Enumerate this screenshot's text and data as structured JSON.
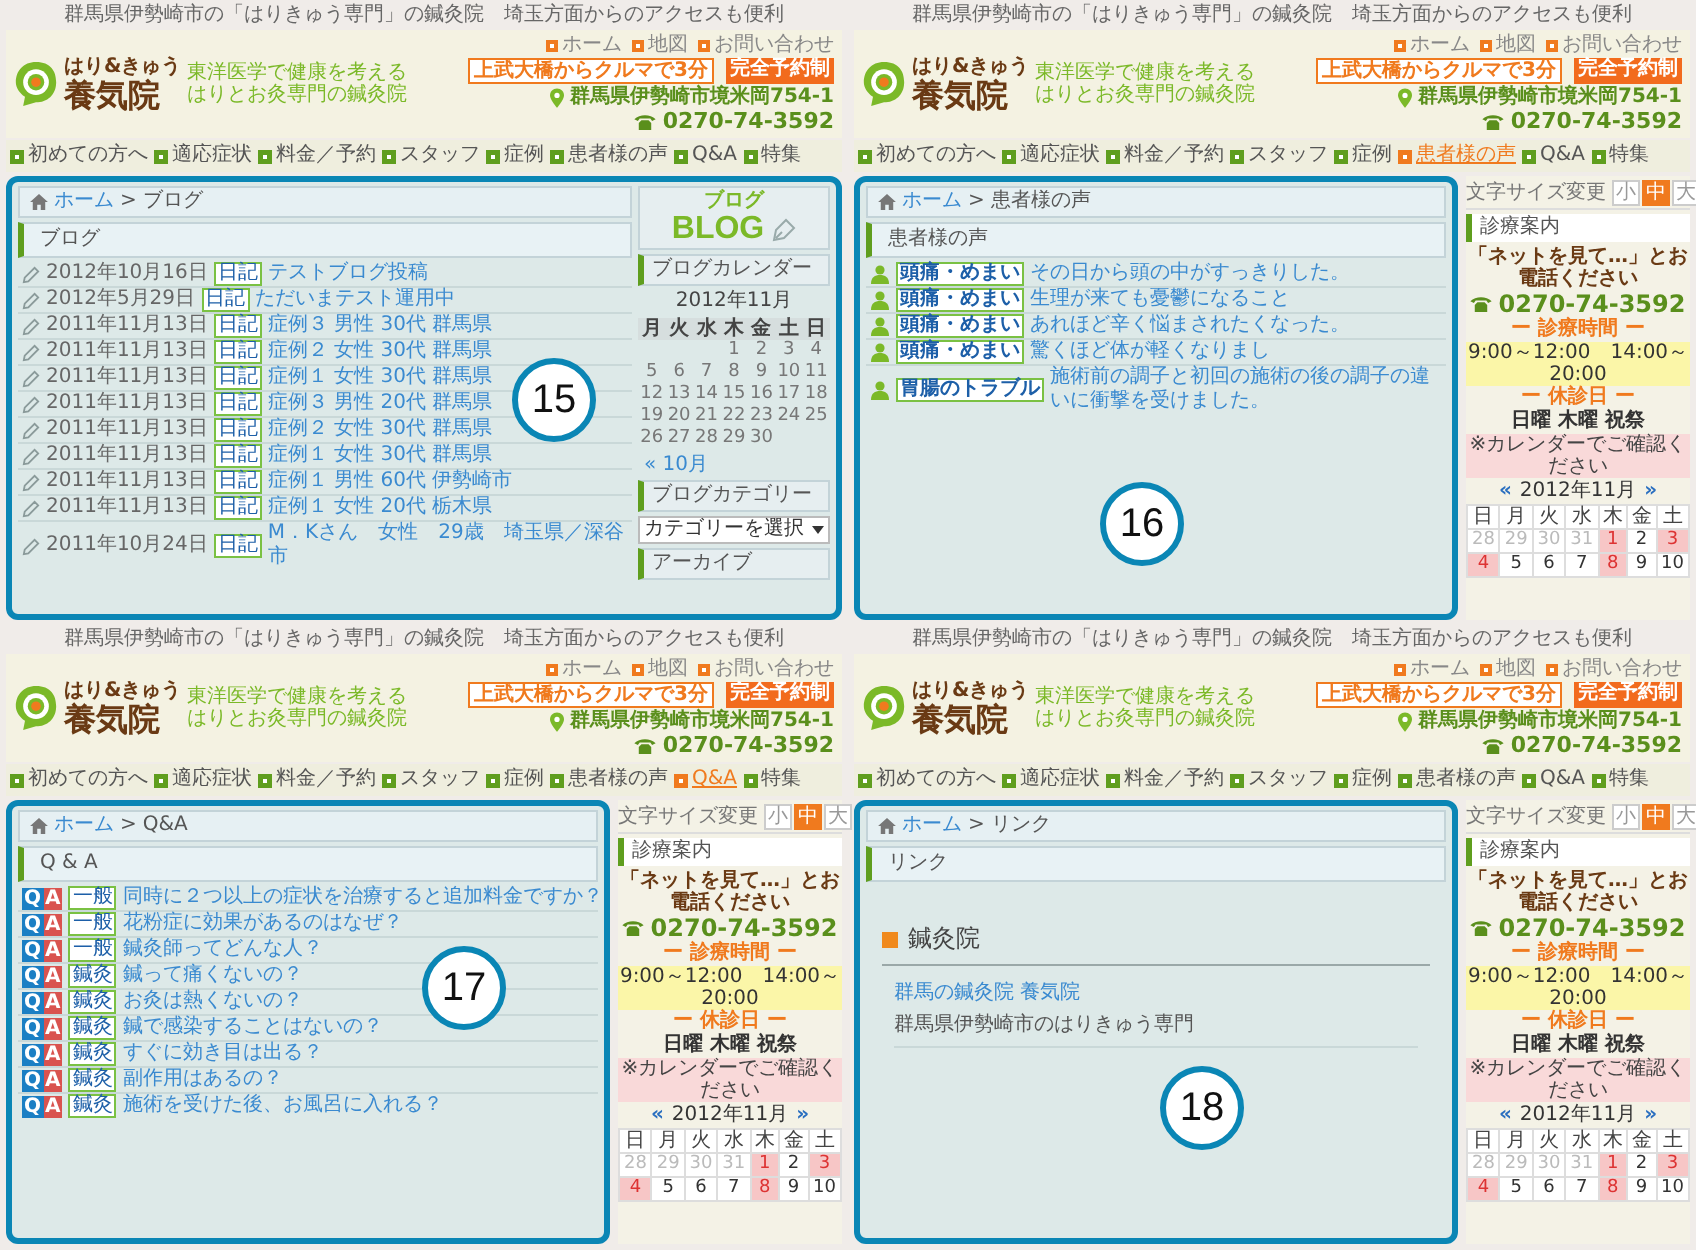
{
  "panels": [
    {
      "number": "15",
      "tagline": "群馬県伊勢崎市の「はりきゅう専門」の鍼灸院　埼玉方面からのアクセスも便利",
      "header": {
        "logo_kana": "はり&きゅう",
        "logo_name": "養気院",
        "logo_sub": [
          "東洋医学で健康を考える",
          "はりとお灸専門の鍼灸院"
        ],
        "links": [
          "ホーム",
          "地図",
          "お問い合わせ"
        ],
        "access": "上武大橋からクルマで3分",
        "reservation": "完全予約制",
        "address": "群馬県伊勢崎市境米岡754-1",
        "phone": "0270-74-3592"
      },
      "nav": [
        {
          "label": "初めての方へ",
          "selected": false
        },
        {
          "label": "適応症状",
          "selected": false
        },
        {
          "label": "料金／予約",
          "selected": false
        },
        {
          "label": "スタッフ",
          "selected": false
        },
        {
          "label": "症例",
          "selected": false
        },
        {
          "label": "患者様の声",
          "selected": false
        },
        {
          "label": "Q&A",
          "selected": false
        },
        {
          "label": "特集",
          "selected": false
        }
      ],
      "breadcrumb": {
        "home": "ホーム",
        "separator": ">",
        "current": "ブログ"
      },
      "heading": "ブログ",
      "content": {
        "kind": "blog",
        "rows": [
          {
            "date": "2012年10月16日",
            "tag": "日記",
            "title": "テストブログ投稿"
          },
          {
            "date": "2012年5月29日",
            "tag": "日記",
            "title": "ただいまテスト運用中"
          },
          {
            "date": "2011年11月13日",
            "tag": "日記",
            "title": "症例３ 男性 30代 群馬県"
          },
          {
            "date": "2011年11月13日",
            "tag": "日記",
            "title": "症例２ 女性 30代 群馬県"
          },
          {
            "date": "2011年11月13日",
            "tag": "日記",
            "title": "症例１ 女性 30代 群馬県"
          },
          {
            "date": "2011年11月13日",
            "tag": "日記",
            "title": "症例３ 男性 20代 群馬県"
          },
          {
            "date": "2011年11月13日",
            "tag": "日記",
            "title": "症例２ 女性 30代 群馬県"
          },
          {
            "date": "2011年11月13日",
            "tag": "日記",
            "title": "症例１ 女性 30代 群馬県"
          },
          {
            "date": "2011年11月13日",
            "tag": "日記",
            "title": "症例１ 男性 60代 伊勢崎市"
          },
          {
            "date": "2011年11月13日",
            "tag": "日記",
            "title": "症例１ 女性 20代 栃木県"
          },
          {
            "date": "2011年10月24日",
            "tag": "日記",
            "title": "M．Kさん　女性　29歳　埼玉県／深谷市"
          }
        ]
      },
      "sidebar": {
        "kind": "blog",
        "banner_kana": "ブログ",
        "banner": "BLOG",
        "calendar_title": "ブログカレンダー",
        "month": "2012年11月",
        "weekdays": [
          "月",
          "火",
          "水",
          "木",
          "金",
          "土",
          "日"
        ],
        "weeks": [
          [
            "1",
            "2",
            "3",
            "4"
          ],
          [
            "5",
            "6",
            "7",
            "8",
            "9",
            "10",
            "11"
          ],
          [
            "12",
            "13",
            "14",
            "15",
            "16",
            "17",
            "18"
          ],
          [
            "19",
            "20",
            "21",
            "22",
            "23",
            "24",
            "25"
          ],
          [
            "26",
            "27",
            "28",
            "29",
            "30"
          ]
        ],
        "prev": "« 10月",
        "category_title": "ブログカテゴリー",
        "category_select": "カテゴリーを選択",
        "archive_title": "アーカイブ"
      }
    },
    {
      "number": "16",
      "tagline": "群馬県伊勢崎市の「はりきゅう専門」の鍼灸院　埼玉方面からのアクセスも便利",
      "header": {
        "logo_kana": "はり&きゅう",
        "logo_name": "養気院",
        "logo_sub": [
          "東洋医学で健康を考える",
          "はりとお灸専門の鍼灸院"
        ],
        "links": [
          "ホーム",
          "地図",
          "お問い合わせ"
        ],
        "access": "上武大橋からクルマで3分",
        "reservation": "完全予約制",
        "address": "群馬県伊勢崎市境米岡754-1",
        "phone": "0270-74-3592"
      },
      "nav": [
        {
          "label": "初めての方へ",
          "selected": false
        },
        {
          "label": "適応症状",
          "selected": false
        },
        {
          "label": "料金／予約",
          "selected": false
        },
        {
          "label": "スタッフ",
          "selected": false
        },
        {
          "label": "症例",
          "selected": false
        },
        {
          "label": "患者様の声",
          "selected": true
        },
        {
          "label": "Q&A",
          "selected": false
        },
        {
          "label": "特集",
          "selected": false
        }
      ],
      "breadcrumb": {
        "home": "ホーム",
        "separator": ">",
        "current": "患者様の声"
      },
      "heading": "患者様の声",
      "content": {
        "kind": "voices",
        "rows": [
          {
            "tag": "頭痛・めまい",
            "text": "その日から頭の中がすっきりした。"
          },
          {
            "tag": "頭痛・めまい",
            "text": "生理が来ても憂鬱になること"
          },
          {
            "tag": "頭痛・めまい",
            "text": "あれほど辛く悩まされた",
            "tail": "くなった。"
          },
          {
            "tag": "頭痛・めまい",
            "text": "驚くほど体が軽くなりまし"
          },
          {
            "tag": "胃腸のトラブル",
            "text": "施術前の調子と初回の施術の後の調子の違いに衝撃を受けました。"
          }
        ]
      },
      "sidebar": {
        "kind": "clinic",
        "font_size_label": "文字サイズ変更",
        "sizes": [
          {
            "label": "小",
            "selected": false
          },
          {
            "label": "中",
            "selected": true
          },
          {
            "label": "大",
            "selected": false
          }
        ],
        "menu_title": "診療案内",
        "call_note": "「ネットを見て…」とお電話ください",
        "phone": "0270-74-3592",
        "hours_title": "ー 診療時間 ー",
        "hours": "9:00～12:00　14:00～20:00",
        "closed_title": "ー 休診日 ー",
        "closed_days": "日曜 木曜 祝祭",
        "calendar_note": "※カレンダーでご確認ください",
        "prev": "«",
        "month": "2012年11月",
        "next": "»",
        "weekdays": [
          "日",
          "月",
          "火",
          "水",
          "木",
          "金",
          "土"
        ],
        "weeks": [
          [
            {
              "day": "28",
              "kind": "other"
            },
            {
              "day": "29",
              "kind": "other"
            },
            {
              "day": "30",
              "kind": "other"
            },
            {
              "day": "31",
              "kind": "other"
            },
            {
              "day": "1",
              "kind": "holiday"
            },
            {
              "day": "2",
              "kind": "day"
            },
            {
              "day": "3",
              "kind": "holiday"
            }
          ],
          [
            {
              "day": "4",
              "kind": "holiday"
            },
            {
              "day": "5",
              "kind": "day"
            },
            {
              "day": "6",
              "kind": "day"
            },
            {
              "day": "7",
              "kind": "day"
            },
            {
              "day": "8",
              "kind": "holiday"
            },
            {
              "day": "9",
              "kind": "day"
            },
            {
              "day": "10",
              "kind": "day"
            }
          ]
        ]
      }
    },
    {
      "number": "17",
      "tagline": "群馬県伊勢崎市の「はりきゅう専門」の鍼灸院　埼玉方面からのアクセスも便利",
      "header": {
        "logo_kana": "はり&きゅう",
        "logo_name": "養気院",
        "logo_sub": [
          "東洋医学で健康を考える",
          "はりとお灸専門の鍼灸院"
        ],
        "links": [
          "ホーム",
          "地図",
          "お問い合わせ"
        ],
        "access": "上武大橋からクルマで3分",
        "reservation": "完全予約制",
        "address": "群馬県伊勢崎市境米岡754-1",
        "phone": "0270-74-3592"
      },
      "nav": [
        {
          "label": "初めての方へ",
          "selected": false
        },
        {
          "label": "適応症状",
          "selected": false
        },
        {
          "label": "料金／予約",
          "selected": false
        },
        {
          "label": "スタッフ",
          "selected": false
        },
        {
          "label": "症例",
          "selected": false
        },
        {
          "label": "患者様の声",
          "selected": false
        },
        {
          "label": "Q&A",
          "selected": true
        },
        {
          "label": "特集",
          "selected": false
        }
      ],
      "breadcrumb": {
        "home": "ホーム",
        "separator": ">",
        "current": "Q&A"
      },
      "heading": "Q & A",
      "content": {
        "kind": "qa",
        "rows": [
          {
            "q": "Q",
            "a": "A",
            "category": "一般",
            "question": "同時に２つ以上の症状を治療すると追加料金ですか？"
          },
          {
            "q": "Q",
            "a": "A",
            "category": "一般",
            "question": "花粉症に効果があるのはなぜ？"
          },
          {
            "q": "Q",
            "a": "A",
            "category": "一般",
            "question": "鍼灸師ってどんな人？"
          },
          {
            "q": "Q",
            "a": "A",
            "category": "鍼灸",
            "question": "鍼って痛くないの？"
          },
          {
            "q": "Q",
            "a": "A",
            "category": "鍼灸",
            "question": "お灸は熱くないの？"
          },
          {
            "q": "Q",
            "a": "A",
            "category": "鍼灸",
            "question": "鍼で感染することはないの？"
          },
          {
            "q": "Q",
            "a": "A",
            "category": "鍼灸",
            "question": "すぐに効き目は出る？"
          },
          {
            "q": "Q",
            "a": "A",
            "category": "鍼灸",
            "question": "副作用はあるの？"
          },
          {
            "q": "Q",
            "a": "A",
            "category": "鍼灸",
            "question": "施術を受けた後、お風呂に入れる？"
          }
        ]
      },
      "sidebar": {
        "kind": "clinic",
        "font_size_label": "文字サイズ変更",
        "sizes": [
          {
            "label": "小",
            "selected": false
          },
          {
            "label": "中",
            "selected": true
          },
          {
            "label": "大",
            "selected": false
          }
        ],
        "menu_title": "診療案内",
        "call_note": "「ネットを見て…」とお電話ください",
        "phone": "0270-74-3592",
        "hours_title": "ー 診療時間 ー",
        "hours": "9:00～12:00　14:00～20:00",
        "closed_title": "ー 休診日 ー",
        "closed_days": "日曜 木曜 祝祭",
        "calendar_note": "※カレンダーでご確認ください",
        "prev": "«",
        "month": "2012年11月",
        "next": "»",
        "weekdays": [
          "日",
          "月",
          "火",
          "水",
          "木",
          "金",
          "土"
        ],
        "weeks": [
          [
            {
              "day": "28",
              "kind": "other"
            },
            {
              "day": "29",
              "kind": "other"
            },
            {
              "day": "30",
              "kind": "other"
            },
            {
              "day": "31",
              "kind": "other"
            },
            {
              "day": "1",
              "kind": "holiday"
            },
            {
              "day": "2",
              "kind": "day"
            },
            {
              "day": "3",
              "kind": "holiday"
            }
          ],
          [
            {
              "day": "4",
              "kind": "holiday"
            },
            {
              "day": "5",
              "kind": "day"
            },
            {
              "day": "6",
              "kind": "day"
            },
            {
              "day": "7",
              "kind": "day"
            },
            {
              "day": "8",
              "kind": "holiday"
            },
            {
              "day": "9",
              "kind": "day"
            },
            {
              "day": "10",
              "kind": "day"
            }
          ]
        ]
      }
    },
    {
      "number": "18",
      "tagline": "群馬県伊勢崎市の「はりきゅう専門」の鍼灸院　埼玉方面からのアクセスも便利",
      "header": {
        "logo_kana": "はり&きゅう",
        "logo_name": "養気院",
        "logo_sub": [
          "東洋医学で健康を考える",
          "はりとお灸専門の鍼灸院"
        ],
        "links": [
          "ホーム",
          "地図",
          "お問い合わせ"
        ],
        "access": "上武大橋からクルマで3分",
        "reservation": "完全予約制",
        "address": "群馬県伊勢崎市境米岡754-1",
        "phone": "0270-74-3592"
      },
      "nav": [
        {
          "label": "初めての方へ",
          "selected": false
        },
        {
          "label": "適応症状",
          "selected": false
        },
        {
          "label": "料金／予約",
          "selected": false
        },
        {
          "label": "スタッフ",
          "selected": false
        },
        {
          "label": "症例",
          "selected": false
        },
        {
          "label": "患者様の声",
          "selected": false
        },
        {
          "label": "Q&A",
          "selected": false
        },
        {
          "label": "特集",
          "selected": false
        }
      ],
      "breadcrumb": {
        "home": "ホーム",
        "separator": ">",
        "current": "リンク"
      },
      "heading": "リンク",
      "content": {
        "kind": "links",
        "section": "鍼灸院",
        "items": [
          {
            "title": "群馬の鍼灸院 養気院",
            "description": "群馬県伊勢崎市のはりきゅう専門"
          }
        ]
      },
      "sidebar": {
        "kind": "clinic",
        "font_size_label": "文字サイズ変更",
        "sizes": [
          {
            "label": "小",
            "selected": false
          },
          {
            "label": "中",
            "selected": true
          },
          {
            "label": "大",
            "selected": false
          }
        ],
        "menu_title": "診療案内",
        "call_note": "「ネットを見て…」とお電話ください",
        "phone": "0270-74-3592",
        "hours_title": "ー 診療時間 ー",
        "hours": "9:00～12:00　14:00～20:00",
        "closed_title": "ー 休診日 ー",
        "closed_days": "日曜 木曜 祝祭",
        "calendar_note": "※カレンダーでご確認ください",
        "prev": "«",
        "month": "2012年11月",
        "next": "»",
        "weekdays": [
          "日",
          "月",
          "火",
          "水",
          "木",
          "金",
          "土"
        ],
        "weeks": [
          [
            {
              "day": "28",
              "kind": "other"
            },
            {
              "day": "29",
              "kind": "other"
            },
            {
              "day": "30",
              "kind": "other"
            },
            {
              "day": "31",
              "kind": "other"
            },
            {
              "day": "1",
              "kind": "holiday"
            },
            {
              "day": "2",
              "kind": "day"
            },
            {
              "day": "3",
              "kind": "holiday"
            }
          ],
          [
            {
              "day": "4",
              "kind": "holiday"
            },
            {
              "day": "5",
              "kind": "day"
            },
            {
              "day": "6",
              "kind": "day"
            },
            {
              "day": "7",
              "kind": "day"
            },
            {
              "day": "8",
              "kind": "holiday"
            },
            {
              "day": "9",
              "kind": "day"
            },
            {
              "day": "10",
              "kind": "day"
            }
          ]
        ]
      }
    }
  ]
}
